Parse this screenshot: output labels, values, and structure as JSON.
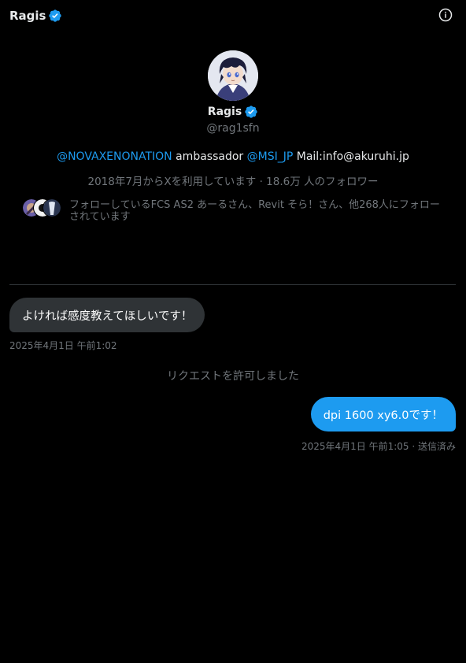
{
  "header": {
    "title": "Ragis",
    "verified_icon": "verified-badge-icon",
    "info_icon": "info-icon"
  },
  "profile": {
    "name": "Ragis",
    "handle": "@rag1sfn",
    "bio": {
      "mention1": "@NOVAXENONATION",
      "text1": " ambassador ",
      "mention2": "@MSI_JP",
      "text2": " Mail:info@akuruhi.jp"
    },
    "meta": "2018年7月からXを利用しています · 18.6万 人のフォロワー",
    "followed_by": "フォローしているFCS AS2 あーるさん、Revit そら！さん、他268人にフォローされています"
  },
  "messages": [
    {
      "direction": "incoming",
      "text": "よければ感度教えてほしいです！",
      "timestamp": "2025年4月1日 午前1:02"
    },
    {
      "direction": "system",
      "text": "リクエストを許可しました"
    },
    {
      "direction": "outgoing",
      "text": "dpi 1600 xy6.0です！",
      "timestamp": "2025年4月1日 午前1:05 · 送信済み"
    }
  ],
  "colors": {
    "background": "#000000",
    "accent": "#1d9bf0",
    "incoming_bubble": "#2f3336",
    "muted_text": "#71767b",
    "primary_text": "#e7e9ea"
  }
}
